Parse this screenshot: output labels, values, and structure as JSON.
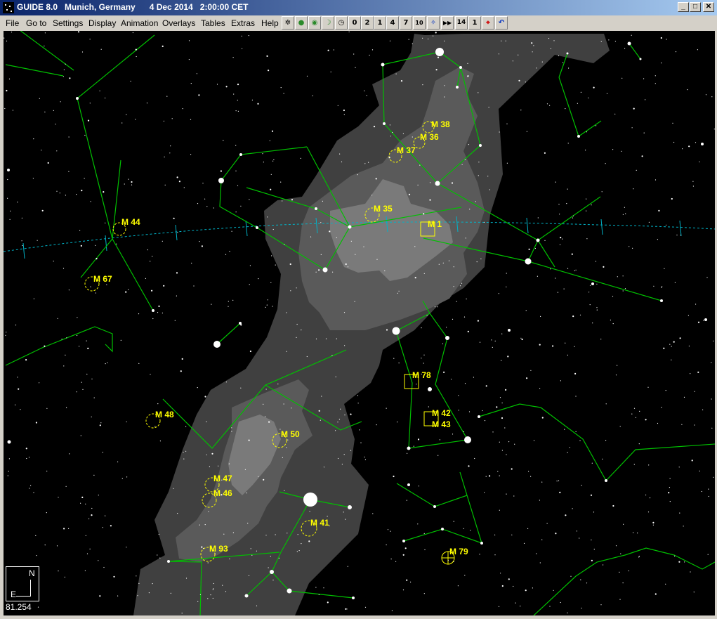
{
  "window": {
    "title": "GUIDE 8.0   Munich, Germany      4 Dec 2014   2:00:00 CET",
    "controls": [
      "_",
      "□",
      "✕"
    ]
  },
  "menu": [
    "File",
    "Go to",
    "Settings",
    "Display",
    "Animation",
    "Overlays",
    "Tables",
    "Extras",
    "Help"
  ],
  "toolbar": [
    {
      "icon": "satellite-icon",
      "glyph": "✲"
    },
    {
      "icon": "planet-icon",
      "glyph": "●"
    },
    {
      "icon": "sun-icon",
      "glyph": "◉"
    },
    {
      "icon": "moon-icon",
      "glyph": "☽"
    },
    {
      "icon": "clock-icon",
      "glyph": "◷"
    },
    {
      "icon": "zoom-0-icon",
      "glyph": "0"
    },
    {
      "icon": "zoom-2-icon",
      "glyph": "2"
    },
    {
      "icon": "zoom-1-icon",
      "glyph": "1"
    },
    {
      "icon": "zoom-4-icon",
      "glyph": "4"
    },
    {
      "icon": "zoom-7-icon",
      "glyph": "7"
    },
    {
      "icon": "zoom-10-icon",
      "glyph": "10"
    },
    {
      "icon": "star-map-icon",
      "glyph": "✧"
    },
    {
      "icon": "fast-forward-icon",
      "glyph": "▶▶"
    },
    {
      "icon": "level-14-icon",
      "glyph": "14"
    },
    {
      "icon": "level-1-icon",
      "glyph": "1"
    },
    {
      "icon": "target-icon",
      "glyph": "⌖"
    },
    {
      "icon": "undo-icon",
      "glyph": "↶"
    }
  ],
  "colors": {
    "sky": "#000000",
    "constellation_line": "#00c000",
    "ecliptic": "#00b4c8",
    "messier_label": "#ffff00",
    "milky_way_outer": "#404040",
    "milky_way_mid": "#5a5a5a",
    "milky_way_inner": "#7a7a7a",
    "star": "#ffffff"
  },
  "objects": [
    {
      "label": "M 38",
      "kind": "open-cluster"
    },
    {
      "label": "M 36",
      "kind": "open-cluster"
    },
    {
      "label": "M 37",
      "kind": "open-cluster"
    },
    {
      "label": "M 35",
      "kind": "open-cluster"
    },
    {
      "label": "M 1",
      "kind": "nebula"
    },
    {
      "label": "M 44",
      "kind": "open-cluster"
    },
    {
      "label": "M 67",
      "kind": "open-cluster"
    },
    {
      "label": "M 78",
      "kind": "nebula"
    },
    {
      "label": "M 42",
      "kind": "nebula"
    },
    {
      "label": "M 43",
      "kind": "nebula"
    },
    {
      "label": "M 48",
      "kind": "open-cluster"
    },
    {
      "label": "M 50",
      "kind": "open-cluster"
    },
    {
      "label": "M 47",
      "kind": "open-cluster"
    },
    {
      "label": "M 46",
      "kind": "open-cluster"
    },
    {
      "label": "M 41",
      "kind": "open-cluster"
    },
    {
      "label": "M 93",
      "kind": "open-cluster"
    },
    {
      "label": "M 79",
      "kind": "globular-cluster"
    }
  ],
  "compass": {
    "north": "N",
    "east": "E"
  },
  "field_of_view": "81.254"
}
